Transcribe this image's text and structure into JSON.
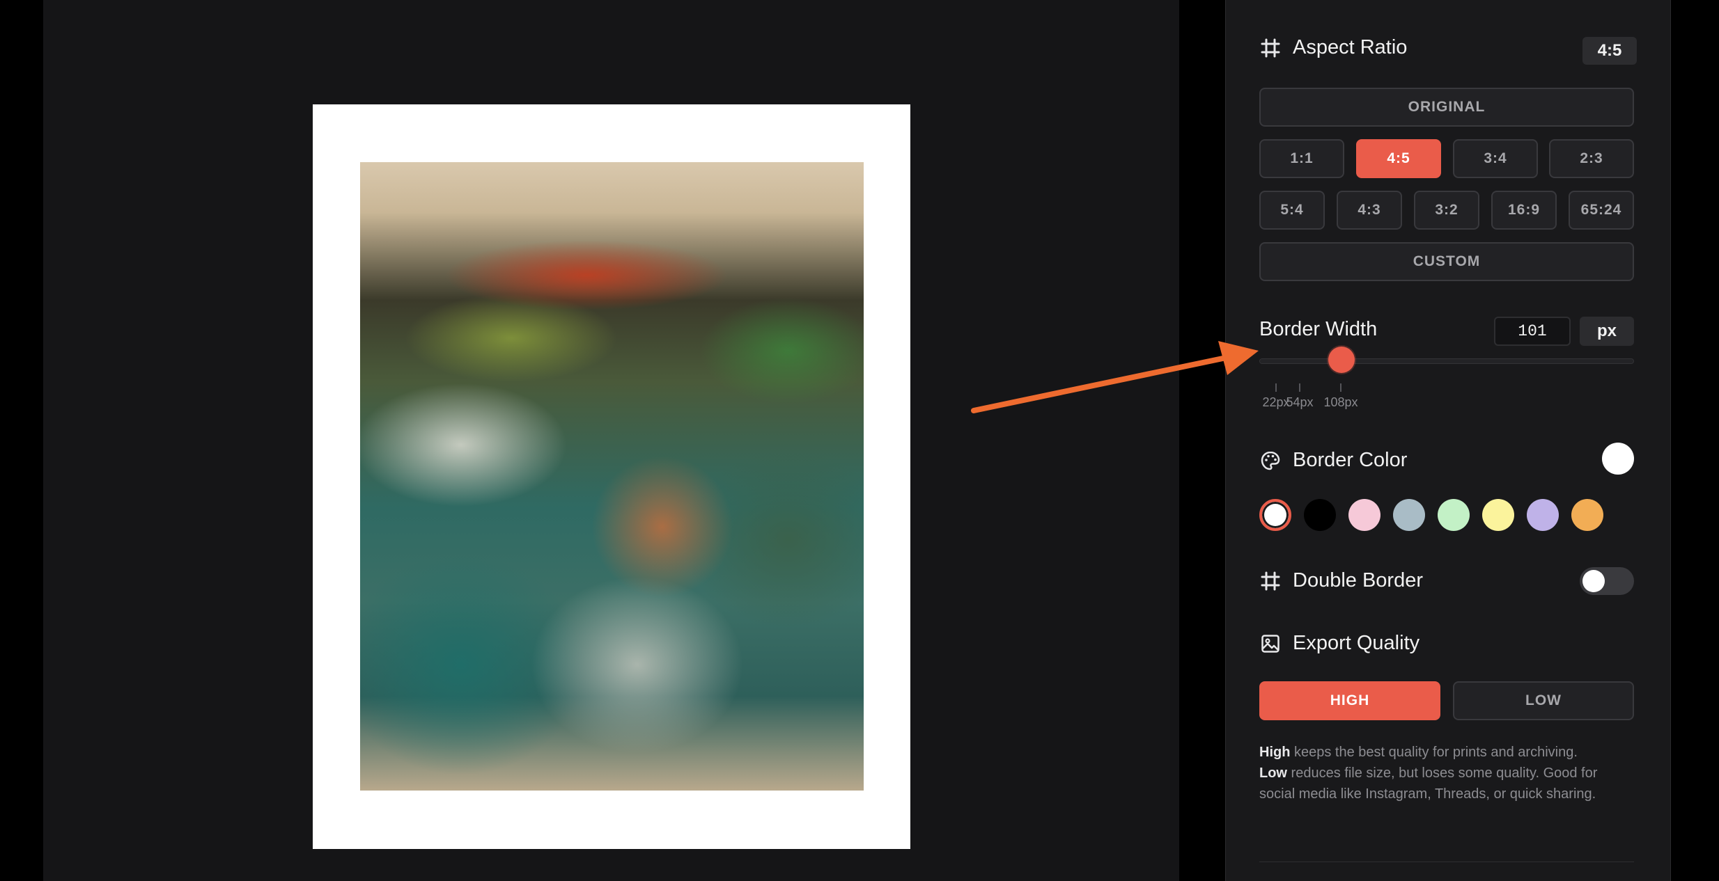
{
  "aspect_ratio": {
    "title": "Aspect Ratio",
    "current_badge": "4:5",
    "original_label": "ORIGINAL",
    "ratios_row1": [
      "1:1",
      "4:5",
      "3:4",
      "2:3"
    ],
    "ratios_row2": [
      "5:4",
      "4:3",
      "3:2",
      "16:9",
      "65:24"
    ],
    "selected": "4:5",
    "custom_label": "CUSTOM"
  },
  "border_width": {
    "title": "Border Width",
    "value": "101",
    "unit": "px",
    "slider_fraction": 0.22,
    "ticks": [
      "22px",
      "54px",
      "108px"
    ]
  },
  "border_color": {
    "title": "Border Color",
    "current": "#ffffff",
    "swatches": [
      "#ffffff",
      "#000000",
      "#f6c9d8",
      "#a9bcc6",
      "#c3f1c6",
      "#fbf39c",
      "#bfb2e8",
      "#f2ad55"
    ],
    "selected_index": 0
  },
  "double_border": {
    "title": "Double Border",
    "enabled": false
  },
  "export_quality": {
    "title": "Export Quality",
    "high_label": "HIGH",
    "low_label": "LOW",
    "selected": "HIGH",
    "help_high_term": "High",
    "help_high_text": " keeps the best quality for prints and archiving.",
    "help_low_term": "Low",
    "help_low_text": " reduces file size, but loses some quality. Good for social media like Instagram, Threads, or quick sharing."
  },
  "colors": {
    "accent": "#ea5c4a",
    "annotation_arrow": "#ee6b2f",
    "panel_bg": "#19191b",
    "canvas_bg": "#151517"
  }
}
